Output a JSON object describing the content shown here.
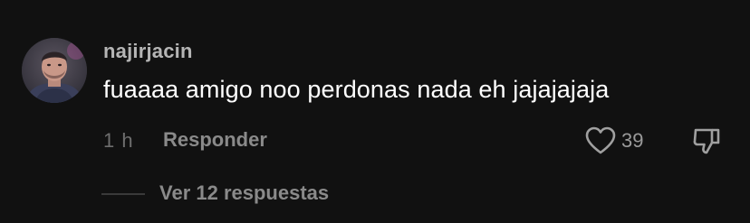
{
  "comment": {
    "avatar_icon": "user-avatar",
    "username": "najirjacin",
    "text": "fuaaaa amigo noo perdonas nada eh jajajajaja",
    "timestamp": "1 h",
    "reply_label": "Responder",
    "like_icon": "heart-outline-icon",
    "like_count": "39",
    "dislike_icon": "thumbs-down-icon"
  },
  "replies": {
    "label": "Ver 12 respuestas"
  },
  "colors": {
    "background": "#111111",
    "username": "#b5b5b5",
    "text": "#ffffff",
    "muted": "#8a8a8a"
  }
}
